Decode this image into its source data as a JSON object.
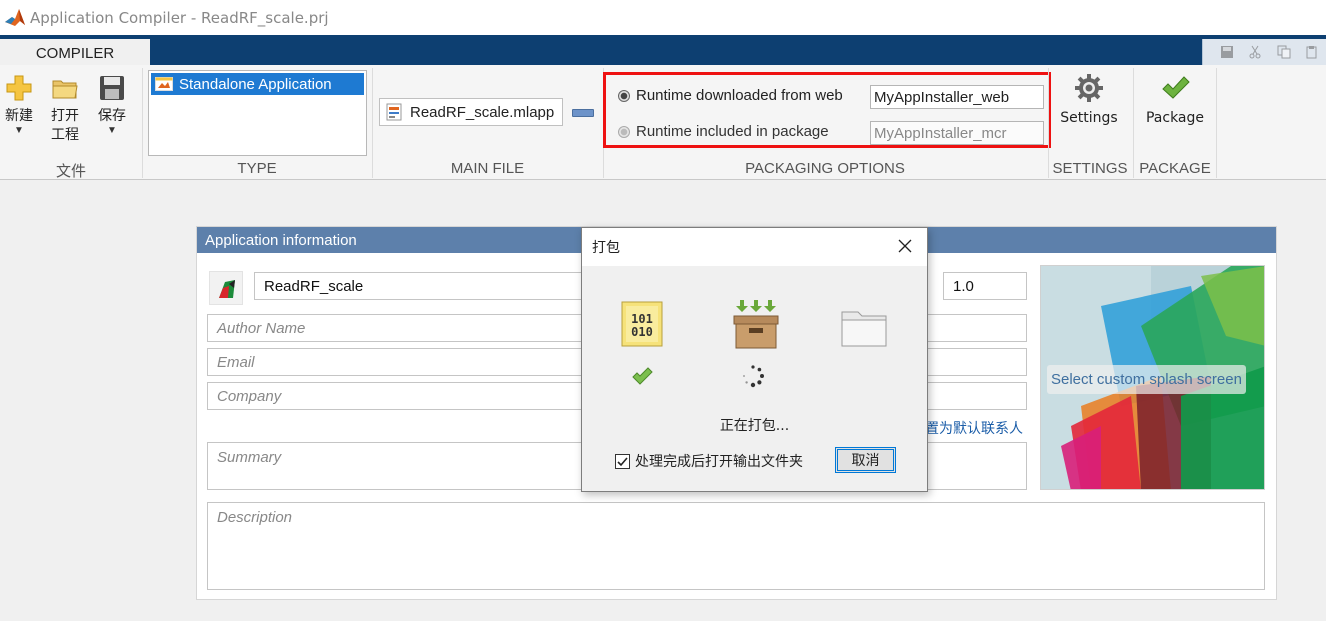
{
  "window": {
    "title": "Application Compiler - ReadRF_scale.prj"
  },
  "tabs": [
    {
      "label": "COMPILER"
    }
  ],
  "ribbon": {
    "file_section": {
      "label": "文件",
      "new_label": "新建",
      "open_label": "打开\n工程",
      "save_label": "保存"
    },
    "type_section": {
      "label": "TYPE",
      "selected_type": "Standalone Application"
    },
    "main_file_section": {
      "label": "MAIN FILE",
      "file_name": "ReadRF_scale.mlapp"
    },
    "packaging_section": {
      "label": "PACKAGING OPTIONS",
      "option_web": "Runtime downloaded from web",
      "option_web_value": "MyAppInstaller_web",
      "option_package": "Runtime included in package",
      "option_package_value": "MyAppInstaller_mcr",
      "selected": "web"
    },
    "settings_section": {
      "label": "SETTINGS",
      "button_label": "Settings"
    },
    "package_section": {
      "label": "PACKAGE",
      "button_label": "Package"
    }
  },
  "app_info": {
    "header": "Application information",
    "app_name": "ReadRF_scale",
    "version": "1.0",
    "author_placeholder": "Author Name",
    "email_placeholder": "Email",
    "company_placeholder": "Company",
    "set_default_contact": "置为默认联系人",
    "summary_placeholder": "Summary",
    "description_placeholder": "Description",
    "splash_label": "Select custom splash screen"
  },
  "dialog": {
    "title": "打包",
    "status": "正在打包...",
    "checkbox_label": "处理完成后打开输出文件夹",
    "checkbox_checked": true,
    "cancel_label": "取消",
    "steps": [
      {
        "icon": "binary-file-icon",
        "state": "done"
      },
      {
        "icon": "package-box-icon",
        "state": "in-progress"
      },
      {
        "icon": "folder-icon",
        "state": "pending"
      }
    ]
  },
  "colors": {
    "tab_strip": "#0d3f71",
    "selection": "#1e7ad2",
    "panel_header": "#5d80ab",
    "highlight_border": "#e11111"
  }
}
